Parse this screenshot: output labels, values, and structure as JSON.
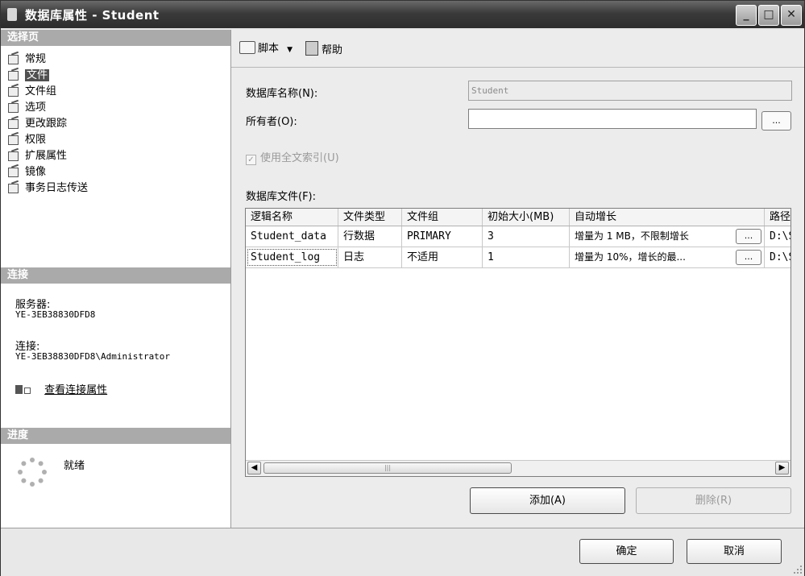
{
  "window": {
    "title": "数据库属性 - Student",
    "controls": [
      "_",
      "□",
      "✕"
    ]
  },
  "left_panel": {
    "select_page_header": "选择页",
    "pages": [
      {
        "label": "常规",
        "selected": false
      },
      {
        "label": "文件",
        "selected": true
      },
      {
        "label": "文件组",
        "selected": false
      },
      {
        "label": "选项",
        "selected": false
      },
      {
        "label": "更改跟踪",
        "selected": false
      },
      {
        "label": "权限",
        "selected": false
      },
      {
        "label": "扩展属性",
        "selected": false
      },
      {
        "label": "镜像",
        "selected": false
      },
      {
        "label": "事务日志传送",
        "selected": false
      }
    ],
    "connection_header": "连接",
    "server_label": "服务器:",
    "server_value": "YE-3EB38830DFD8",
    "connection_label": "连接:",
    "connection_value": "YE-3EB38830DFD8\\Administrator",
    "view_connection_link": "查看连接属性",
    "progress_header": "进度",
    "progress_status": "就绪"
  },
  "toolbar": {
    "script_label": "脚本",
    "help_label": "帮助"
  },
  "form": {
    "db_name_label": "数据库名称(N):",
    "db_name_value": "Student",
    "owner_label": "所有者(O):",
    "owner_value": "",
    "browse_label": "...",
    "fulltext_label": "使用全文索引(U)",
    "fulltext_checked": true,
    "db_files_label": "数据库文件(F):"
  },
  "files_table": {
    "columns": [
      "逻辑名称",
      "文件类型",
      "文件组",
      "初始大小(MB)",
      "自动增长",
      "路径"
    ],
    "rows": [
      {
        "logical_name": "Student_data",
        "file_type": "行数据",
        "filegroup": "PRIMARY",
        "initial_size": "3",
        "autogrowth": "增量为 1 MB，不限制增长",
        "browse": "...",
        "path": "D:\\S"
      },
      {
        "logical_name": "Student_log",
        "file_type": "日志",
        "filegroup": "不适用",
        "initial_size": "1",
        "autogrowth": "增量为 10%，增长的最...",
        "browse": "...",
        "path": "D:\\S"
      }
    ]
  },
  "buttons": {
    "add": "添加(A)",
    "remove": "删除(R)",
    "ok": "确定",
    "cancel": "取消"
  }
}
